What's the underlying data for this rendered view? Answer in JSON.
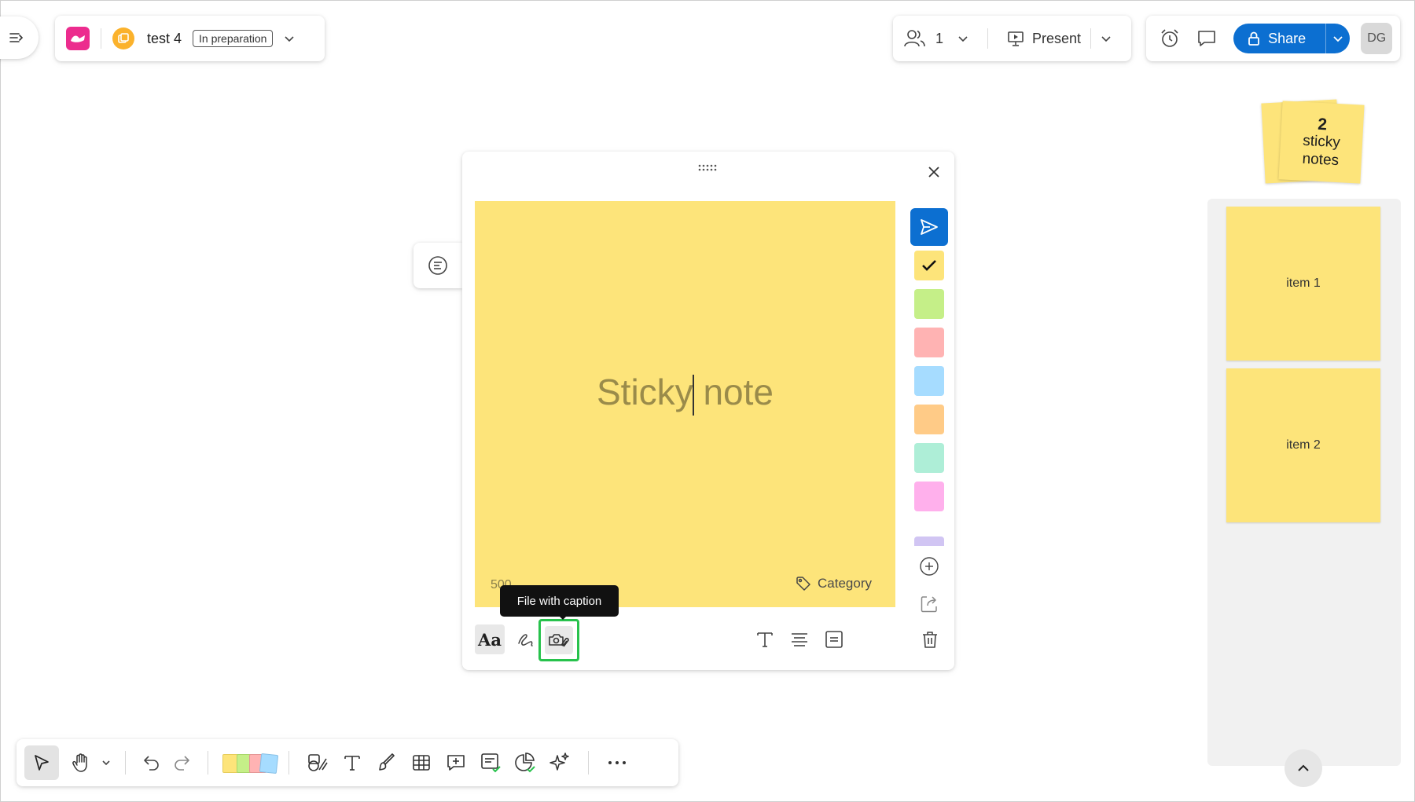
{
  "header": {
    "board_name": "test 4",
    "status": "In preparation"
  },
  "collaboration": {
    "user_count": "1",
    "present_label": "Present"
  },
  "actions": {
    "share_label": "Share",
    "avatar_initials": "DG"
  },
  "stack_indicator": {
    "count": "2",
    "label_line1": "sticky",
    "label_line2": "notes"
  },
  "side_panel": {
    "items": [
      {
        "label": "item 1"
      },
      {
        "label": "item 2"
      }
    ]
  },
  "editor": {
    "placeholder_before": "Sticky",
    "placeholder_after": " note",
    "char_count": "500",
    "category_label": "Category",
    "tooltip": "File with caption",
    "format_label": "Aa",
    "selected_color": "#fde47a",
    "colors": [
      "#fde47a",
      "#c5ef88",
      "#ffb3b3",
      "#a6dcff",
      "#ffcb87",
      "#aeeed7",
      "#ffb0ec",
      "#d1c5f3"
    ]
  },
  "bottom_toolbar": {
    "tools": [
      "select-tool",
      "hand-tool",
      "undo",
      "redo",
      "sticky-notes",
      "shapes",
      "text",
      "pen",
      "table",
      "comment",
      "card",
      "chart",
      "ai-assist",
      "more"
    ]
  }
}
